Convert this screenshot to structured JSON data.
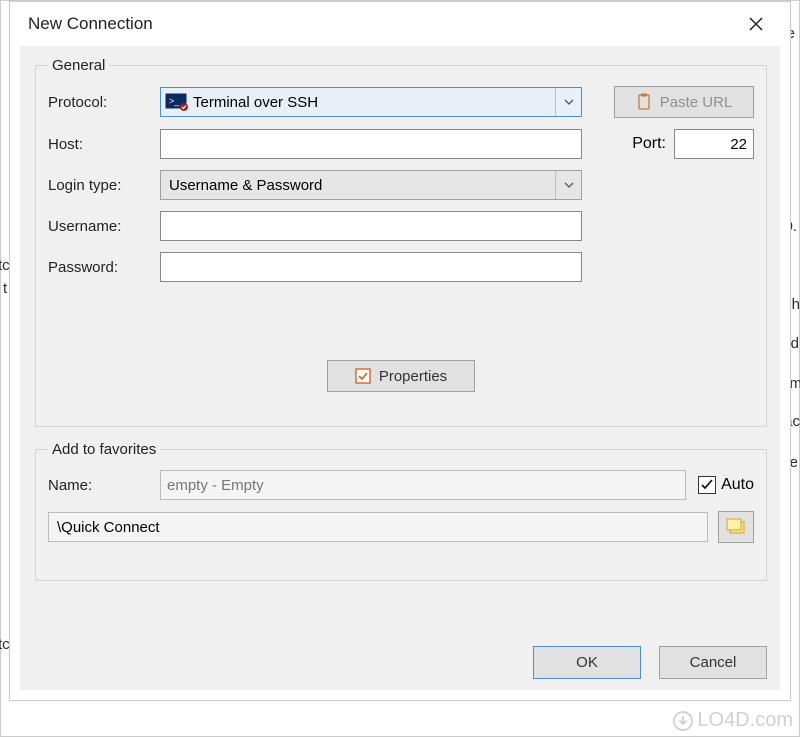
{
  "dialog": {
    "title": "New Connection",
    "general": {
      "legend": "General",
      "protocol_label": "Protocol:",
      "protocol_value": "Terminal over SSH",
      "paste_url": "Paste URL",
      "host_label": "Host:",
      "host_value": "",
      "port_label": "Port:",
      "port_value": "22",
      "login_type_label": "Login type:",
      "login_type_value": "Username & Password",
      "username_label": "Username:",
      "username_value": "",
      "password_label": "Password:",
      "password_value": "",
      "properties_label": "Properties"
    },
    "favorites": {
      "legend": "Add to favorites",
      "name_label": "Name:",
      "name_value": "empty - Empty",
      "auto_label": "Auto",
      "auto_checked": true,
      "path_value": "\\Quick Connect"
    },
    "ok_label": "OK",
    "cancel_label": "Cancel"
  },
  "bg": {
    "f1": "e",
    "f2": "0.",
    "f3": "tc",
    "f4": "t",
    "f5": "tc",
    "f6": "ch",
    "f7": "d",
    "f8": "m",
    "f9": "ac",
    "f10": "e"
  },
  "watermark": "LO4D.com"
}
